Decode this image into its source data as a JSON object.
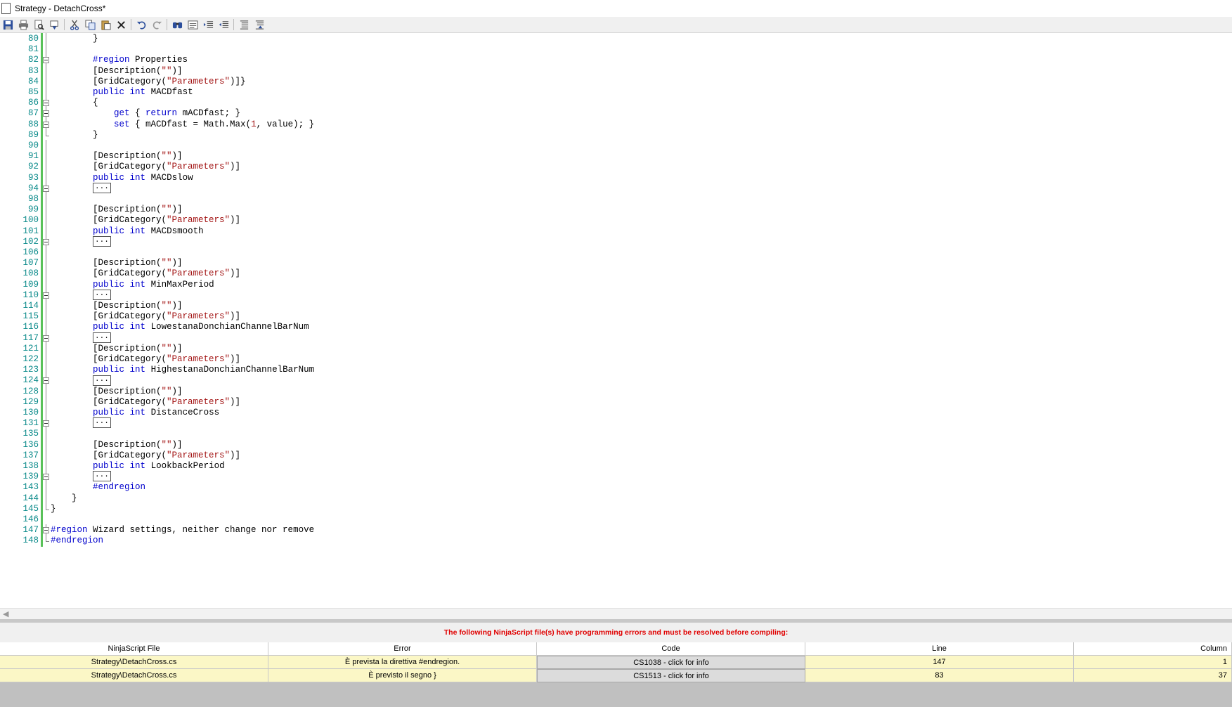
{
  "window": {
    "title": "Strategy - DetachCross*"
  },
  "toolbar": {
    "buttons": [
      "save-icon",
      "print-icon",
      "print-preview-icon",
      "insert-icon",
      "cut-icon",
      "copy-icon",
      "paste-icon",
      "delete-icon",
      "undo-icon",
      "redo-icon",
      "find-icon",
      "find-replace-icon",
      "indent-icon",
      "outdent-icon",
      "comment-icon",
      "uncomment-icon"
    ]
  },
  "editor": {
    "lines": [
      {
        "n": "80",
        "fold": "line",
        "html": "        }"
      },
      {
        "n": "81",
        "fold": "line",
        "html": ""
      },
      {
        "n": "82",
        "fold": "box",
        "html": "        <span class=\"kw\">#region</span> Properties"
      },
      {
        "n": "83",
        "fold": "line",
        "html": "        [Description(<span class=\"st\">\"\"</span>)]"
      },
      {
        "n": "84",
        "fold": "line",
        "html": "        [GridCategory(<span class=\"st\">\"Parameters\"</span>)]}"
      },
      {
        "n": "85",
        "fold": "line",
        "html": "        <span class=\"kw\">public</span> <span class=\"kw\">int</span> MACDfast"
      },
      {
        "n": "86",
        "fold": "box",
        "html": "        {"
      },
      {
        "n": "87",
        "fold": "box",
        "html": "            <span class=\"kw\">get</span> { <span class=\"kw\">return</span> mACDfast; }"
      },
      {
        "n": "88",
        "fold": "box",
        "html": "            <span class=\"kw\">set</span> { mACDfast = Math.Max(<span class=\"nm\">1</span>, value); }"
      },
      {
        "n": "89",
        "fold": "end",
        "html": "        }"
      },
      {
        "n": "90",
        "fold": "line",
        "html": ""
      },
      {
        "n": "91",
        "fold": "line",
        "html": "        [Description(<span class=\"st\">\"\"</span>)]"
      },
      {
        "n": "92",
        "fold": "line",
        "html": "        [GridCategory(<span class=\"st\">\"Parameters\"</span>)]"
      },
      {
        "n": "93",
        "fold": "line",
        "html": "        <span class=\"kw\">public</span> <span class=\"kw\">int</span> MACDslow"
      },
      {
        "n": "94",
        "fold": "box",
        "html": "        <span class=\"ell\">...</span>"
      },
      {
        "n": "98",
        "fold": "line",
        "html": ""
      },
      {
        "n": "99",
        "fold": "line",
        "html": "        [Description(<span class=\"st\">\"\"</span>)]"
      },
      {
        "n": "100",
        "fold": "line",
        "html": "        [GridCategory(<span class=\"st\">\"Parameters\"</span>)]"
      },
      {
        "n": "101",
        "fold": "line",
        "html": "        <span class=\"kw\">public</span> <span class=\"kw\">int</span> MACDsmooth"
      },
      {
        "n": "102",
        "fold": "box",
        "html": "        <span class=\"ell\">...</span>"
      },
      {
        "n": "106",
        "fold": "line",
        "html": ""
      },
      {
        "n": "107",
        "fold": "line",
        "html": "        [Description(<span class=\"st\">\"\"</span>)]"
      },
      {
        "n": "108",
        "fold": "line",
        "html": "        [GridCategory(<span class=\"st\">\"Parameters\"</span>)]"
      },
      {
        "n": "109",
        "fold": "line",
        "html": "        <span class=\"kw\">public</span> <span class=\"kw\">int</span> MinMaxPeriod"
      },
      {
        "n": "110",
        "fold": "box",
        "html": "        <span class=\"ell\">...</span>"
      },
      {
        "n": "114",
        "fold": "line",
        "html": "        [Description(<span class=\"st\">\"\"</span>)]"
      },
      {
        "n": "115",
        "fold": "line",
        "html": "        [GridCategory(<span class=\"st\">\"Parameters\"</span>)]"
      },
      {
        "n": "116",
        "fold": "line",
        "html": "        <span class=\"kw\">public</span> <span class=\"kw\">int</span> LowestanaDonchianChannelBarNum"
      },
      {
        "n": "117",
        "fold": "box",
        "html": "        <span class=\"ell\">...</span>"
      },
      {
        "n": "121",
        "fold": "line",
        "html": "        [Description(<span class=\"st\">\"\"</span>)]"
      },
      {
        "n": "122",
        "fold": "line",
        "html": "        [GridCategory(<span class=\"st\">\"Parameters\"</span>)]"
      },
      {
        "n": "123",
        "fold": "line",
        "html": "        <span class=\"kw\">public</span> <span class=\"kw\">int</span> HighestanaDonchianChannelBarNum"
      },
      {
        "n": "124",
        "fold": "box",
        "html": "        <span class=\"ell\">...</span>"
      },
      {
        "n": "128",
        "fold": "line",
        "html": "        [Description(<span class=\"st\">\"\"</span>)]"
      },
      {
        "n": "129",
        "fold": "line",
        "html": "        [GridCategory(<span class=\"st\">\"Parameters\"</span>)]"
      },
      {
        "n": "130",
        "fold": "line",
        "html": "        <span class=\"kw\">public</span> <span class=\"kw\">int</span> DistanceCross"
      },
      {
        "n": "131",
        "fold": "box",
        "html": "        <span class=\"ell\">...</span>"
      },
      {
        "n": "135",
        "fold": "line",
        "html": ""
      },
      {
        "n": "136",
        "fold": "line",
        "html": "        [Description(<span class=\"st\">\"\"</span>)]"
      },
      {
        "n": "137",
        "fold": "line",
        "html": "        [GridCategory(<span class=\"st\">\"Parameters\"</span>)]"
      },
      {
        "n": "138",
        "fold": "line",
        "html": "        <span class=\"kw\">public</span> <span class=\"kw\">int</span> LookbackPeriod"
      },
      {
        "n": "139",
        "fold": "box",
        "html": "        <span class=\"ell\">...</span>"
      },
      {
        "n": "143",
        "fold": "line",
        "html": "        <span class=\"kw\">#endregion</span>"
      },
      {
        "n": "144",
        "fold": "line",
        "html": "    }"
      },
      {
        "n": "145",
        "fold": "end",
        "html": "}"
      },
      {
        "n": "146",
        "fold": "none",
        "html": ""
      },
      {
        "n": "147",
        "fold": "box",
        "html": "<span class=\"kw\">#region</span> Wizard settings, neither change nor remove"
      },
      {
        "n": "148",
        "fold": "end",
        "html": "<span class=\"kw\">#endregion</span>"
      }
    ]
  },
  "errors": {
    "header": "The following NinjaScript file(s) have programming errors and must be resolved before compiling:",
    "columns": [
      "NinjaScript File",
      "Error",
      "Code",
      "Line",
      "Column"
    ],
    "rows": [
      {
        "file": "Strategy\\DetachCross.cs",
        "error": "È prevista la direttiva #endregion.",
        "code": "CS1038 - click for info",
        "line": "147",
        "column": "1"
      },
      {
        "file": "Strategy\\DetachCross.cs",
        "error": "È previsto il segno }",
        "code": "CS1513 - click for info",
        "line": "83",
        "column": "37"
      }
    ]
  },
  "colors": {
    "accent_error": "#e00000",
    "row_highlight": "#fbf7c6",
    "keyword": "#0000cc",
    "string": "#a31515",
    "line_number": "#0a8a8a",
    "gutter_changed": "#59c159"
  }
}
